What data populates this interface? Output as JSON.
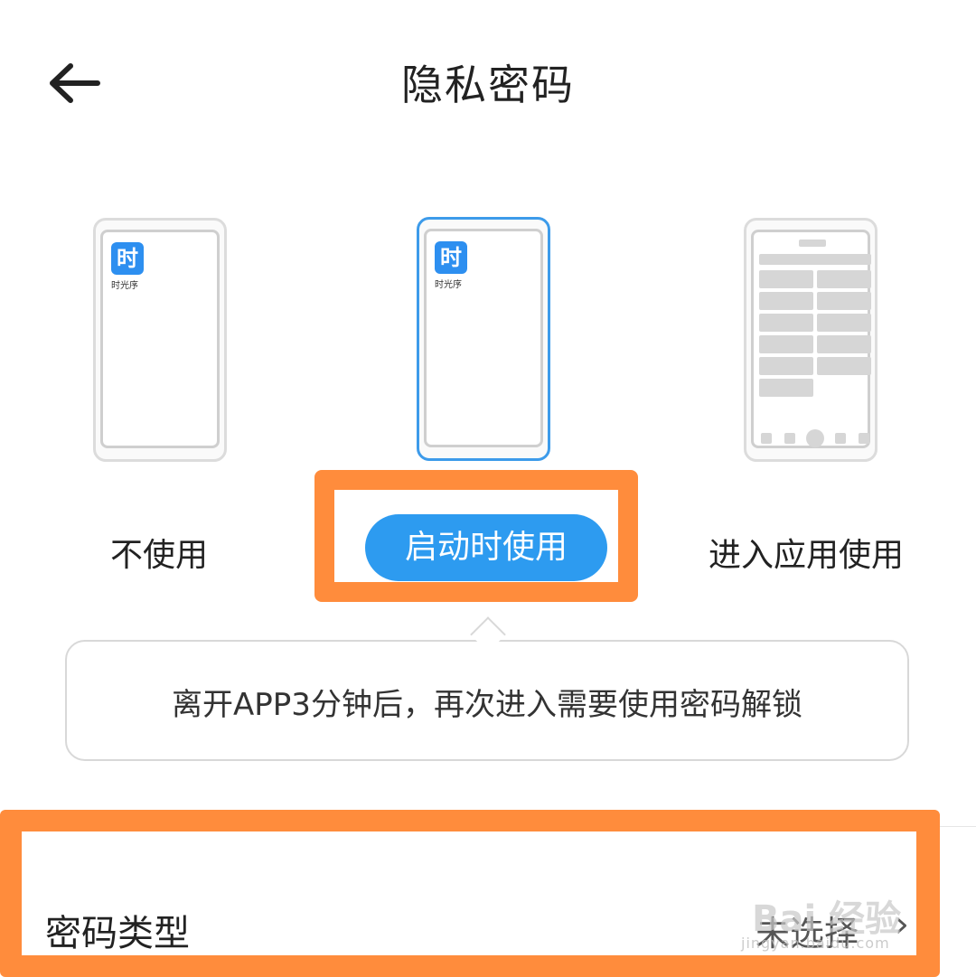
{
  "header": {
    "title": "隐私密码",
    "back_icon": "arrow-left-icon"
  },
  "options": [
    {
      "label": "不使用",
      "selected": false
    },
    {
      "label": "启动时使用",
      "selected": true
    },
    {
      "label": "进入应用使用",
      "selected": false
    }
  ],
  "preview": {
    "app_icon_char": "时",
    "app_name": "时光序"
  },
  "tooltip": {
    "text": "离开APP3分钟后，再次进入需要使用密码解锁"
  },
  "password_type": {
    "label": "密码类型",
    "value": "未选择",
    "chevron": "›"
  },
  "watermark": {
    "logo": "Bai 经验",
    "url": "jingyan.baidu.com"
  },
  "colors": {
    "accent": "#2d9bf0",
    "highlight": "#ff8c3c",
    "selected_border": "#3d9bea"
  }
}
